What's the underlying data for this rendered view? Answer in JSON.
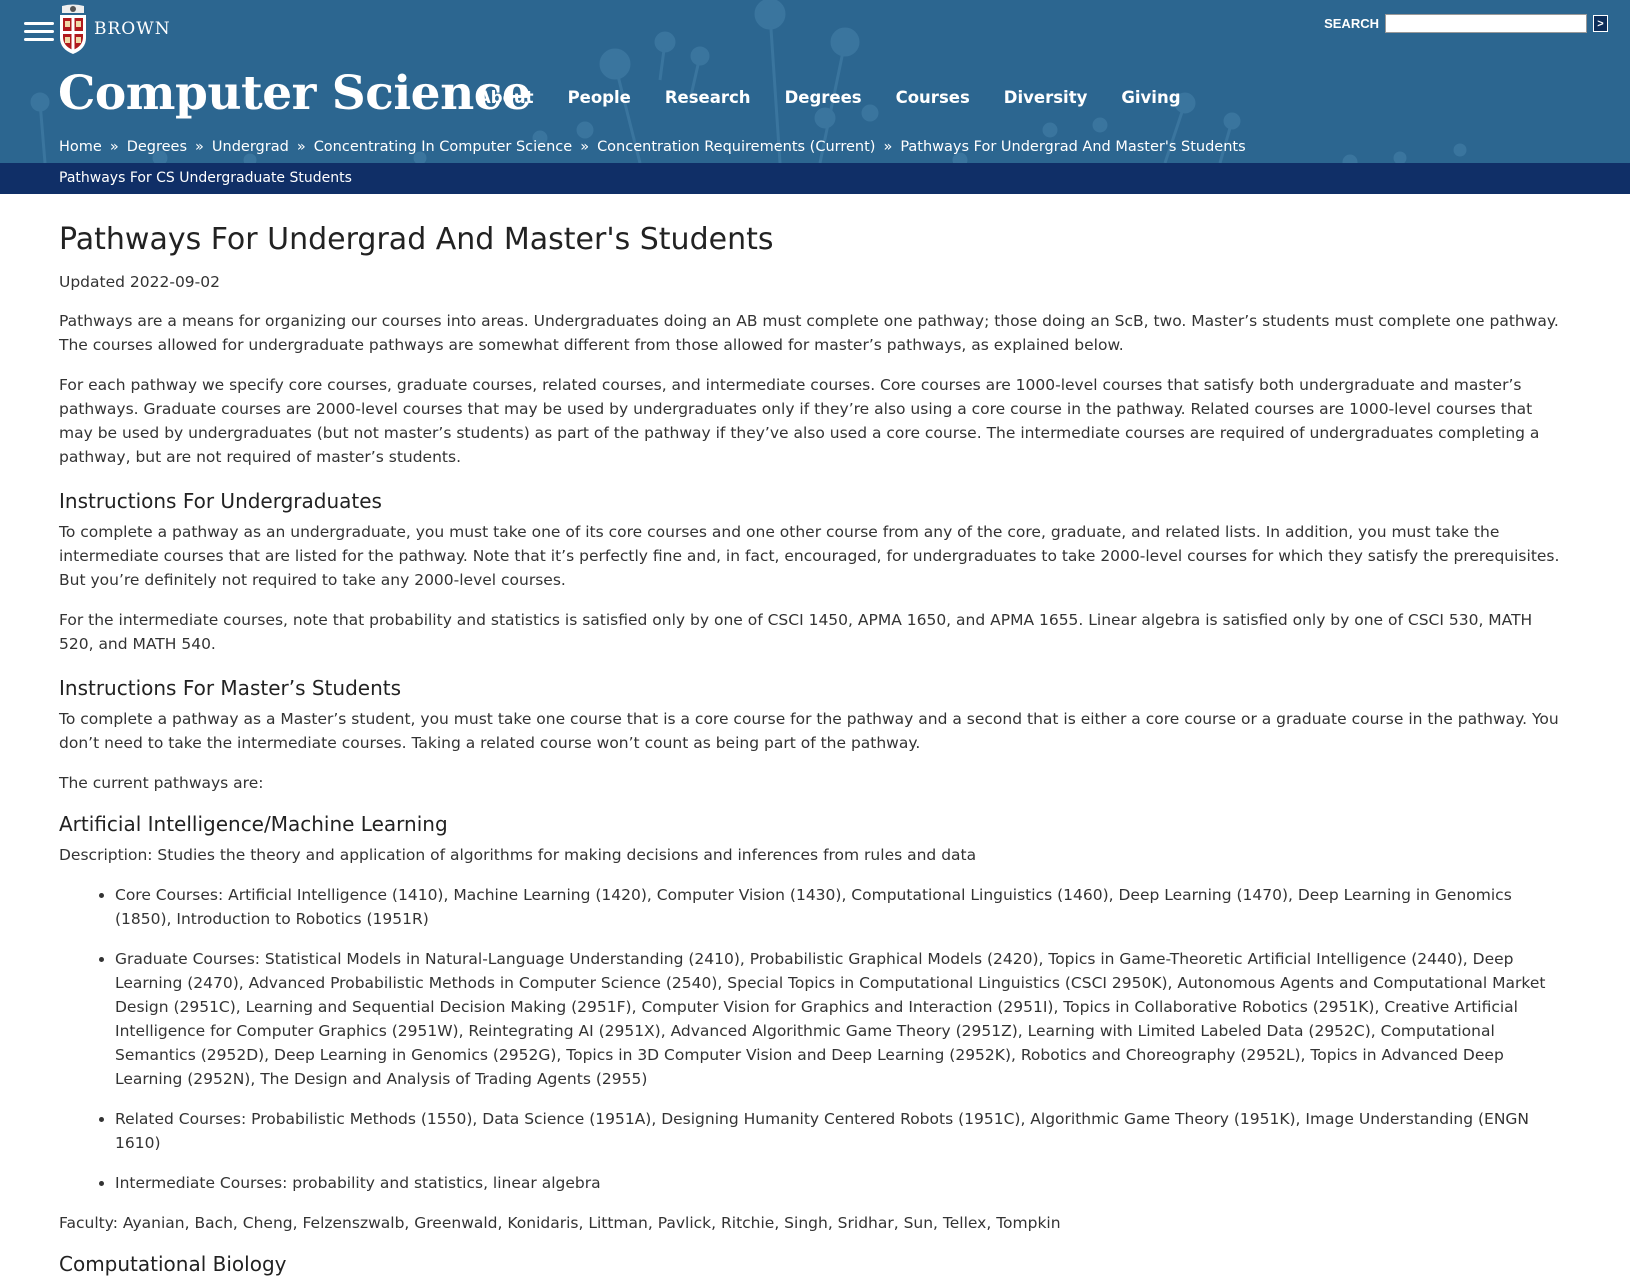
{
  "header": {
    "logo_text": "BROWN",
    "search_label": "SEARCH",
    "search_button": ">",
    "site_title": "Computer Science",
    "nav": [
      "About",
      "People",
      "Research",
      "Degrees",
      "Courses",
      "Diversity",
      "Giving"
    ],
    "breadcrumb": [
      "Home",
      "Degrees",
      "Undergrad",
      "Concentrating In Computer Science",
      "Concentration Requirements (Current)",
      "Pathways For Undergrad And Master's Students"
    ],
    "breadcrumb_sep": "»",
    "subnav_link": "Pathways For CS Undergraduate Students",
    "colors": {
      "header_bg": "#2c6690",
      "subnav_bg": "#102f67"
    }
  },
  "page": {
    "title": "Pathways For Undergrad And Master's Students",
    "updated": "Updated 2022-09-02",
    "intro1": "Pathways are a means for organizing our courses into areas. Undergraduates doing an AB must complete one pathway; those doing an ScB, two. Master’s students must complete one pathway. The courses allowed for undergraduate pathways are somewhat different from those allowed for master’s pathways, as explained below.",
    "intro2": "For each pathway we specify core courses, graduate courses, related courses, and intermediate courses. Core courses are 1000-level courses that satisfy both undergraduate and master’s pathways. Graduate courses are 2000-level courses that may be used by undergraduates only if they’re also using a core course in the pathway. Related courses are 1000-level courses that may be used by undergraduates (but not master’s students) as part of the pathway if they’ve also used a core course. The intermediate courses are required of undergraduates completing a pathway, but are not required of master’s students.",
    "undergrad_heading": "Instructions For Undergraduates",
    "undergrad_p1": "To complete a pathway as an undergraduate, you must take one of its core courses and one other course from any of the core, graduate, and related lists. In addition, you must take the intermediate courses that are listed for the pathway. Note that it’s perfectly fine and, in fact, encouraged, for undergraduates to take 2000-level courses for which they satisfy the prerequisites. But you’re definitely not required to take any 2000-level courses.",
    "undergrad_p2": "For the intermediate courses, note that probability and statistics is satisfied only by one of CSCI 1450, APMA 1650, and APMA 1655. Linear algebra is satisfied only by one of CSCI 530, MATH 520, and MATH 540.",
    "masters_heading": "Instructions For Master’s Students",
    "masters_p1": "To complete a pathway as a Master’s student, you must take one course that is a core course for the pathway and a second that is either a core course or a graduate course in the pathway. You don’t need to take the intermediate courses.  Taking a related course won’t count as being part of the pathway.",
    "current_pathways": "The current pathways are:",
    "aiml_heading": "Artificial Intelligence/Machine Learning",
    "aiml_description": "Description: Studies the theory and application of algorithms for making decisions and inferences from rules and data",
    "aiml_items": [
      "Core Courses: Artificial Intelligence (1410), Machine Learning (1420), Computer Vision (1430), Computational Linguistics (1460), Deep Learning (1470), Deep Learning in Genomics (1850), Introduction to Robotics (1951R)",
      "Graduate Courses: Statistical Models in Natural-Language Understanding (2410), Probabilistic Graphical Models (2420), Topics in Game-Theoretic Artificial Intelligence (2440), Deep Learning (2470), Advanced Probabilistic Methods in Computer Science (2540), Special Topics in Computational Linguistics (CSCI 2950K), Autonomous Agents and Computational Market Design (2951C), Learning and Sequential Decision Making (2951F), Computer Vision for Graphics and Interaction (2951I), Topics in Collaborative Robotics (2951K), Creative Artificial Intelligence for Computer Graphics (2951W), Reintegrating AI (2951X), Advanced Algorithmic Game Theory (2951Z), Learning with Limited Labeled Data (2952C), Computational Semantics (2952D), Deep Learning in Genomics (2952G), Topics in 3D Computer Vision and Deep Learning (2952K), Robotics and Choreography (2952L), Topics in Advanced Deep Learning (2952N), The Design and Analysis of Trading Agents (2955)",
      "Related Courses: Probabilistic Methods (1550), Data Science (1951A), Designing Humanity Centered Robots (1951C), Algorithmic Game Theory (1951K), Image Understanding (ENGN 1610)",
      "Intermediate Courses: probability and statistics, linear algebra"
    ],
    "aiml_faculty": "Faculty: Ayanian, Bach, Cheng, Felzenszwalb, Greenwald, Konidaris, Littman, Pavlick, Ritchie, Singh, Sridhar, Sun, Tellex, Tompkin",
    "compbio_heading": "Computational Biology"
  }
}
